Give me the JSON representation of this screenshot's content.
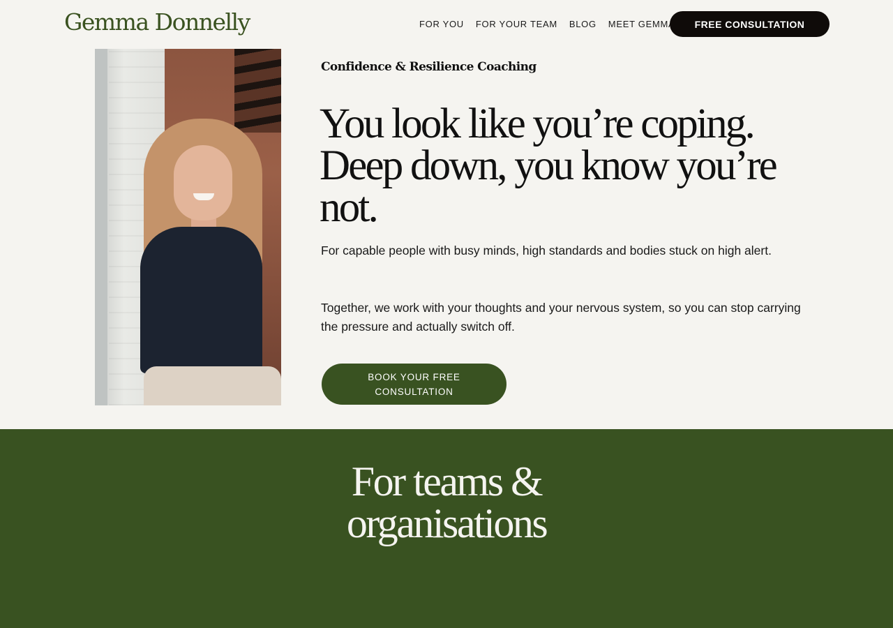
{
  "header": {
    "logo": "Gemma Donnelly",
    "nav": [
      {
        "label": "FOR YOU"
      },
      {
        "label": "FOR YOUR TEAM"
      },
      {
        "label": "BLOG"
      },
      {
        "label": "MEET GEMMA"
      }
    ],
    "cta_label": "FREE CONSULTATION"
  },
  "hero": {
    "photo_alt": "Portrait of a smiling woman with long wavy hair",
    "eyebrow": "Confidence & Resilience Coaching",
    "headline": "You look like you’re coping. Deep down, you know you’re not.",
    "paragraphs": [
      "For capable people with busy minds, high standards and bodies stuck on high alert.",
      "Together, we work with your thoughts and your nervous system, so you can stop carrying the pressure and actually switch off."
    ],
    "cta_label": "BOOK YOUR FREE CONSULTATION"
  },
  "teams": {
    "title": "For teams & organisations"
  },
  "colors": {
    "background": "#f5f4f0",
    "brand_green": "#395221",
    "dark_button": "#0f0b09",
    "text": "#111111"
  }
}
